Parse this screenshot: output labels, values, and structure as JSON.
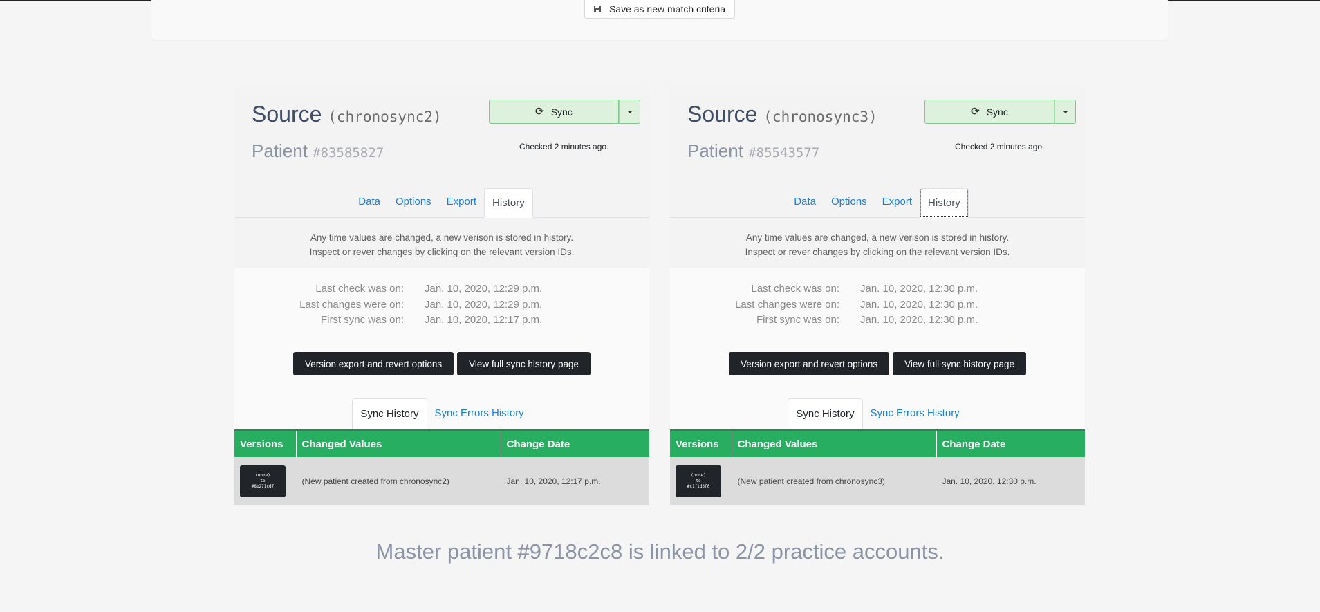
{
  "top": {
    "save_label": "Save as new match criteria",
    "save_icon": "floppy-disk-icon"
  },
  "panels": [
    {
      "source_label": "Source",
      "source_name": "(chronosync2)",
      "patient_label": "Patient",
      "patient_id": "#83585827",
      "sync_label": "Sync",
      "checked": "Checked 2 minutes ago.",
      "tabs": [
        "Data",
        "Options",
        "Export",
        "History"
      ],
      "active_tab": "History",
      "desc_line1": "Any time values are changed, a new verison is stored in history.",
      "desc_line2": "Inspect or rever changes by clicking on the relevant version IDs.",
      "info": [
        {
          "label": "Last check was on:",
          "value": "Jan. 10, 2020, 12:29 p.m."
        },
        {
          "label": "Last changes were on:",
          "value": "Jan. 10, 2020, 12:29 p.m."
        },
        {
          "label": "First sync was on:",
          "value": "Jan. 10, 2020, 12:17 p.m."
        }
      ],
      "btn_export": "Version export and revert options",
      "btn_full": "View full sync history page",
      "sub_tabs": [
        "Sync History",
        "Sync Errors History"
      ],
      "table_headers": [
        "Versions",
        "Changed Values",
        "Change Date"
      ],
      "rows": [
        {
          "ver_from": "(none)",
          "ver_to": "to",
          "ver_id": "#8b271cd7",
          "changed": "(New patient created from chronosync2)",
          "date": "Jan. 10, 2020, 12:17 p.m."
        }
      ]
    },
    {
      "source_label": "Source",
      "source_name": "(chronosync3)",
      "patient_label": "Patient",
      "patient_id": "#85543577",
      "sync_label": "Sync",
      "checked": "Checked 2 minutes ago.",
      "tabs": [
        "Data",
        "Options",
        "Export",
        "History"
      ],
      "active_tab": "History",
      "desc_line1": "Any time values are changed, a new verison is stored in history.",
      "desc_line2": "Inspect or rever changes by clicking on the relevant version IDs.",
      "info": [
        {
          "label": "Last check was on:",
          "value": "Jan. 10, 2020, 12:30 p.m."
        },
        {
          "label": "Last changes were on:",
          "value": "Jan. 10, 2020, 12:30 p.m."
        },
        {
          "label": "First sync was on:",
          "value": "Jan. 10, 2020, 12:30 p.m."
        }
      ],
      "btn_export": "Version export and revert options",
      "btn_full": "View full sync history page",
      "sub_tabs": [
        "Sync History",
        "Sync Errors History"
      ],
      "table_headers": [
        "Versions",
        "Changed Values",
        "Change Date"
      ],
      "rows": [
        {
          "ver_from": "(none)",
          "ver_to": "to",
          "ver_id": "#c1f1d3f0",
          "changed": "(New patient created from chronosync3)",
          "date": "Jan. 10, 2020, 12:30 p.m."
        }
      ]
    }
  ],
  "master": "Master patient #9718c2c8 is linked to 2/2 practice accounts."
}
